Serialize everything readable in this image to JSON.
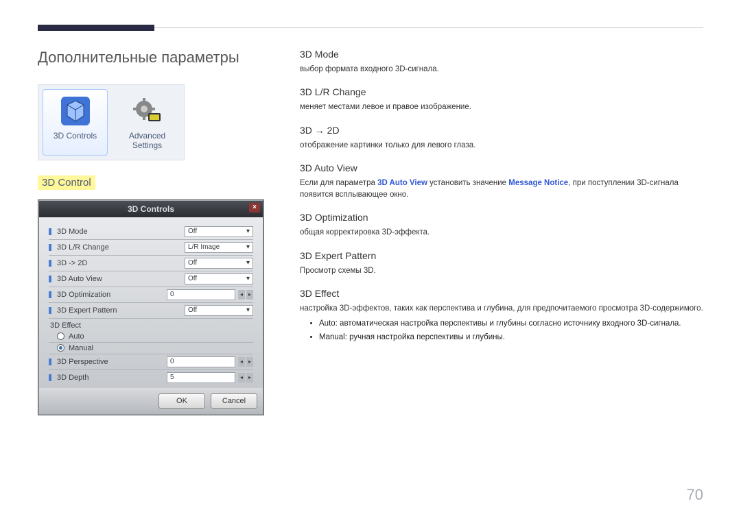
{
  "page_title": "Дополнительные параметры",
  "page_number": "70",
  "left_cards": {
    "card1_label": "3D Controls",
    "card2_label": "Advanced Settings"
  },
  "section_highlight": "3D Control",
  "dialog": {
    "title": "3D Controls",
    "close_glyph": "×",
    "rows": [
      {
        "label": "3D Mode",
        "value": "Off"
      },
      {
        "label": "3D L/R Change",
        "value": "L/R Image"
      },
      {
        "label": "3D -> 2D",
        "value": "Off"
      },
      {
        "label": "3D Auto View",
        "value": "Off"
      },
      {
        "label": "3D Optimization",
        "value": "0"
      },
      {
        "label": "3D Expert Pattern",
        "value": "Off"
      }
    ],
    "section_label": "3D Effect",
    "radio_auto": "Auto",
    "radio_manual": "Manual",
    "perspective_label": "3D Perspective",
    "perspective_value": "0",
    "depth_label": "3D Depth",
    "depth_value": "5",
    "ok_label": "OK",
    "cancel_label": "Cancel"
  },
  "right": {
    "s1_head": "3D Mode",
    "s1_desc": "выбор формата входного 3D-сигнала.",
    "s2_head": "3D L/R Change",
    "s2_desc": "меняет местами левое и правое изображение.",
    "s3_head": "3D → 2D",
    "s3_desc": "отображение картинки только для левого глаза.",
    "s4_head": "3D Auto View",
    "s4_desc_a": "Если для параметра ",
    "s4_kw1": "3D Auto View",
    "s4_desc_b": " установить значение ",
    "s4_kw2": "Message Notice",
    "s4_desc_c": ", при поступлении 3D-сигнала появится всплывающее окно.",
    "s5_head": "3D Optimization",
    "s5_desc": "общая корректировка 3D-эффекта.",
    "s6_head": "3D Expert Pattern",
    "s6_desc": "Просмотр схемы 3D.",
    "s7_head": "3D Effect",
    "s7_desc": "настройка 3D-эффектов, таких как перспектива и глубина, для предпочитаемого просмотра 3D-содержимого.",
    "s7_b1_kw": "Auto",
    "s7_b1_txt": ": автоматическая настройка перспективы и глубины согласно источнику входного 3D-сигнала.",
    "s7_b2_kw": "Manual",
    "s7_b2_txt": ": ручная настройка перспективы и глубины."
  }
}
